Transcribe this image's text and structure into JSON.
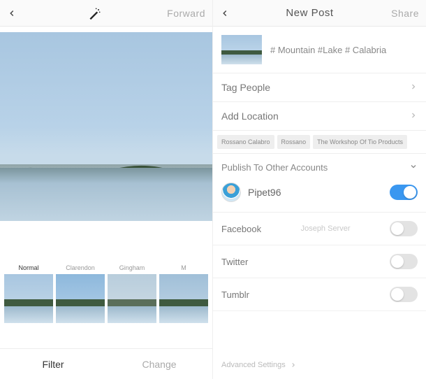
{
  "left": {
    "topbar": {
      "forward_label": "Forward"
    },
    "filters": [
      {
        "key": "normal",
        "label": "Normal",
        "active": true
      },
      {
        "key": "clarendon",
        "label": "Clarendon",
        "active": false
      },
      {
        "key": "gingham",
        "label": "Gingham",
        "active": false
      },
      {
        "key": "m",
        "label": "M",
        "active": false
      }
    ],
    "tabs": {
      "filter_label": "Filter",
      "change_label": "Change"
    }
  },
  "right": {
    "topbar": {
      "title": "New Post",
      "share_label": "Share"
    },
    "caption": "# Mountain #Lake # Calabria",
    "tag_people_label": "Tag People",
    "add_location_label": "Add Location",
    "location_chips": [
      "Rossano Calabro",
      "Rossano",
      "The Workshop Of Tio Products"
    ],
    "publish_header": "Publish To Other Accounts",
    "account": {
      "username": "Pipet96",
      "enabled": true
    },
    "services": [
      {
        "name": "Facebook",
        "subtext": "Joseph Server",
        "enabled": false
      },
      {
        "name": "Twitter",
        "subtext": "",
        "enabled": false
      },
      {
        "name": "Tumblr",
        "subtext": "",
        "enabled": false
      }
    ],
    "advanced_label": "Advanced Settings"
  }
}
